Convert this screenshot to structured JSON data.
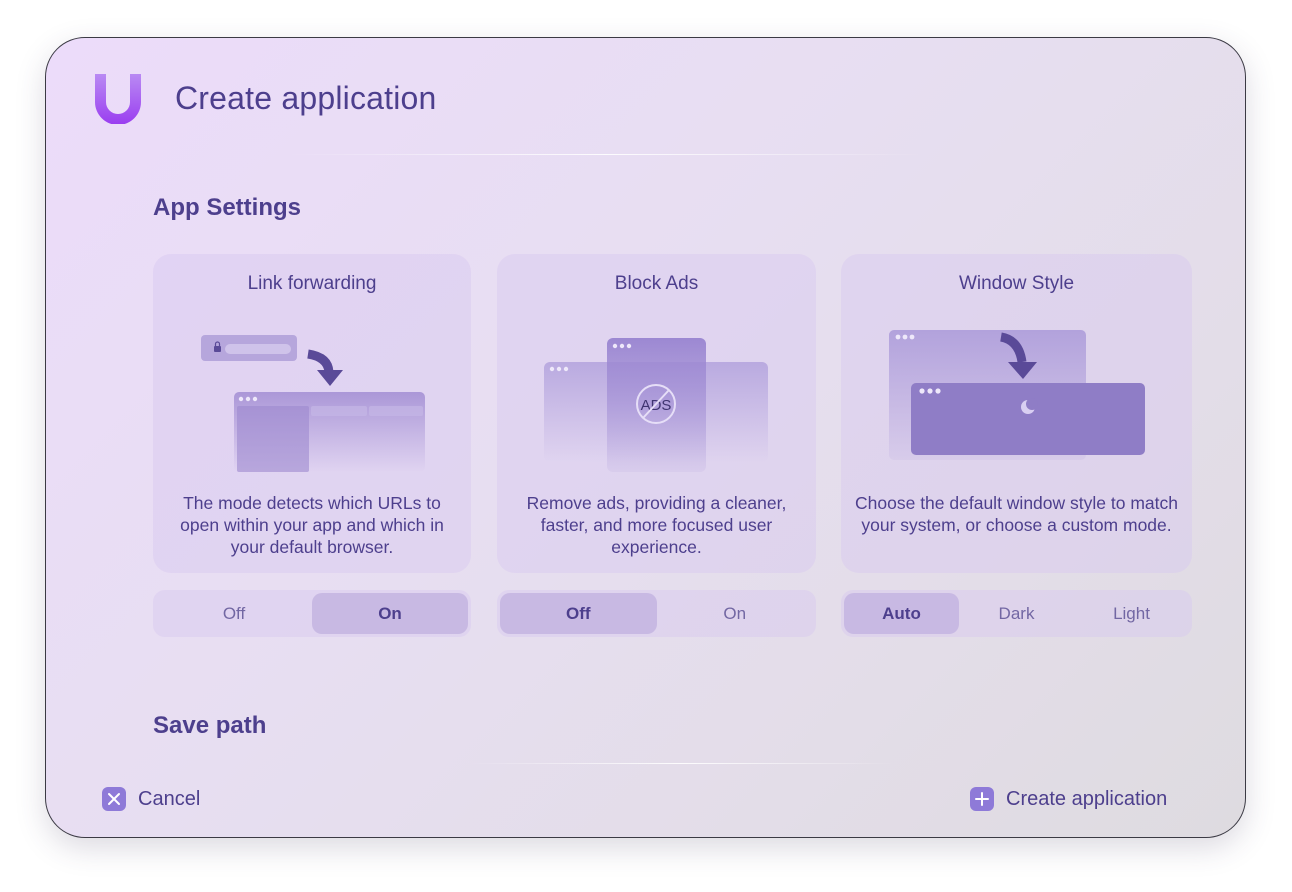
{
  "header": {
    "title": "Create application"
  },
  "sections": {
    "app_settings": "App Settings",
    "save_path": "Save path"
  },
  "cards": [
    {
      "title": "Link forwarding",
      "description": "The mode detects which URLs to open within your app and which in your default browser.",
      "options": [
        "Off",
        "On"
      ],
      "selected": "On"
    },
    {
      "title": "Block Ads",
      "description": "Remove ads, providing a cleaner, faster, and more focused user experience.",
      "illustration_label": "ADS",
      "options": [
        "Off",
        "On"
      ],
      "selected": "Off"
    },
    {
      "title": "Window Style",
      "description": "Choose the default window style to match your system, or choose a custom mode.",
      "options": [
        "Auto",
        "Dark",
        "Light"
      ],
      "selected": "Auto"
    }
  ],
  "footer": {
    "cancel_label": "Cancel",
    "create_label": "Create application"
  },
  "colors": {
    "accent": "#4d3f8d",
    "button_icon": "#8e7ad8",
    "segment_active": "#c8b9e3",
    "logo_gradient": [
      "#b072f0",
      "#9a3df0"
    ]
  },
  "icons": {
    "logo": "app-logo-u",
    "cancel": "close-icon",
    "create": "plus-icon",
    "lock": "lock-icon",
    "arrow": "curved-arrow-icon",
    "moon": "moon-icon"
  }
}
